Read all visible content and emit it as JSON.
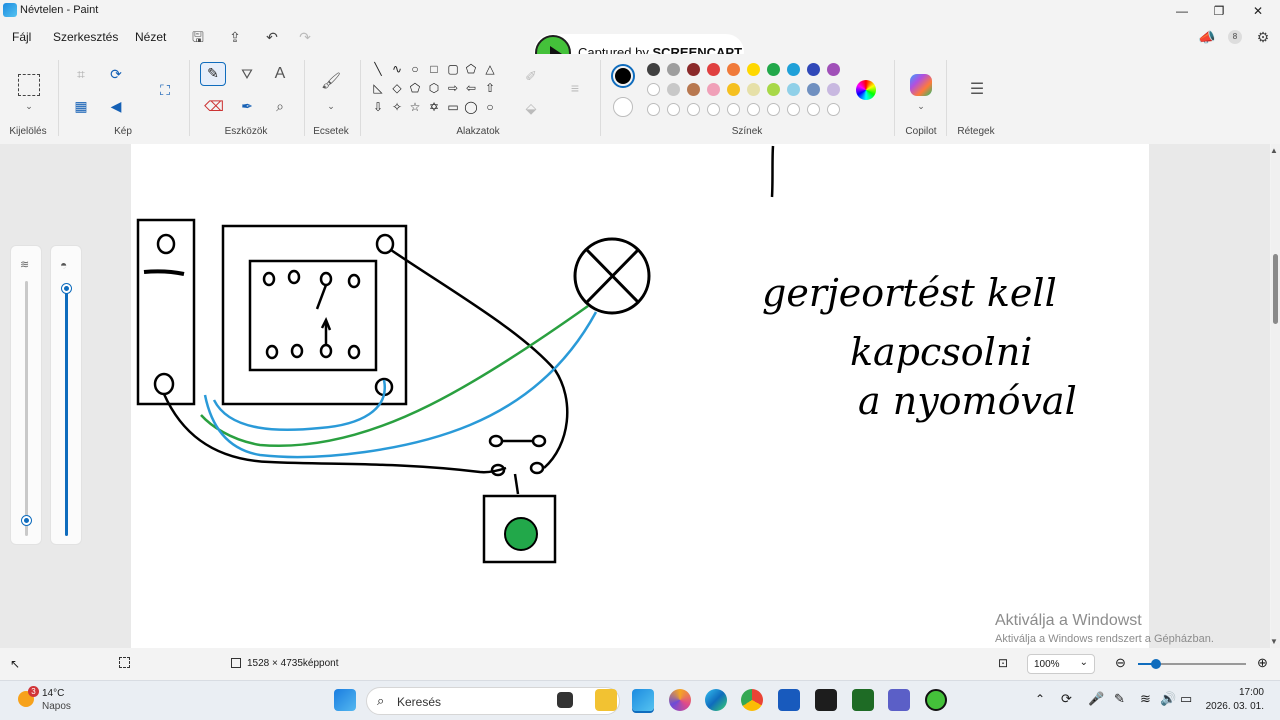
{
  "window": {
    "title": "Névtelen - Paint",
    "minimize": "—",
    "maximize": "❐",
    "close": "✕"
  },
  "menu": {
    "file": "Fájl",
    "edit": "Szerkesztés",
    "view": "Nézet"
  },
  "screencapt_badge": {
    "prefix": "Captured by",
    "brand": "SCREENCAPT"
  },
  "ribbon_groups": {
    "selection": "Kijelölés",
    "image": "Kép",
    "tools": "Eszközök",
    "brushes": "Ecsetek",
    "shapes": "Alakzatok",
    "colors": "Színek",
    "copilot": "Copilot",
    "layers": "Rétegek"
  },
  "colors": {
    "selected_primary": "#000000",
    "selected_secondary": "#ffffff",
    "row1": [
      "#404040",
      "#9e9e9e",
      "#8b2a2a",
      "#e04040",
      "#f07a3a",
      "#ffd800",
      "#22a84a",
      "#1fa0d8",
      "#3048b8",
      "#a050b8"
    ],
    "row2": [
      "#ffffff",
      "#c8c8c8",
      "#b87850",
      "#f0a0b8",
      "#f5c020",
      "#e6e0a8",
      "#a8d848",
      "#90d0e8",
      "#7090c0",
      "#c8b8e0"
    ],
    "empty_count": 10
  },
  "status": {
    "dimensions": "1528 × 4735képpont",
    "zoom": "100%"
  },
  "watermark": {
    "line1": "Aktiválja a Windowst",
    "line2": "Aktiválja a Windows rendszert a Gépházban."
  },
  "taskbar": {
    "weather_temp": "14°C",
    "weather_desc": "Napos",
    "weather_badge": "3",
    "search_placeholder": "Keresés",
    "time": "17:00",
    "date": "2026. 03. 01."
  },
  "drawing": {
    "handwriting_lines": [
      "gerjeortést kell",
      "kapcsolni",
      "a nyomóval"
    ]
  }
}
